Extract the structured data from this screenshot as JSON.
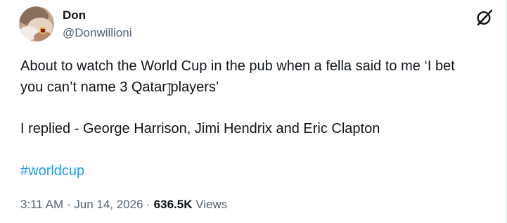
{
  "author": {
    "name": "Don",
    "handle": "@Donwillioni"
  },
  "tweet": {
    "line1": "About to watch the World Cup in the pub when a fella said to me ‘I bet",
    "line2": "you can’t name 3 Qatar players’",
    "line3": "I replied - George Harrison, Jimi Hendrix and Eric Clapton",
    "hashtag": "#worldcup"
  },
  "meta": {
    "time": "3:11 AM",
    "separator1": " · ",
    "date": "Jun 14, 2026",
    "separator2": " · ",
    "views_count": "636.5K",
    "views_label": " Views"
  },
  "icons": {
    "logo": "x-logo-icon",
    "avatar": "avatar-photo",
    "cursor": "text-cursor-icon"
  },
  "colors": {
    "link": "#1d9bf0",
    "secondary_text": "#536471",
    "primary_text": "#0f1419"
  }
}
